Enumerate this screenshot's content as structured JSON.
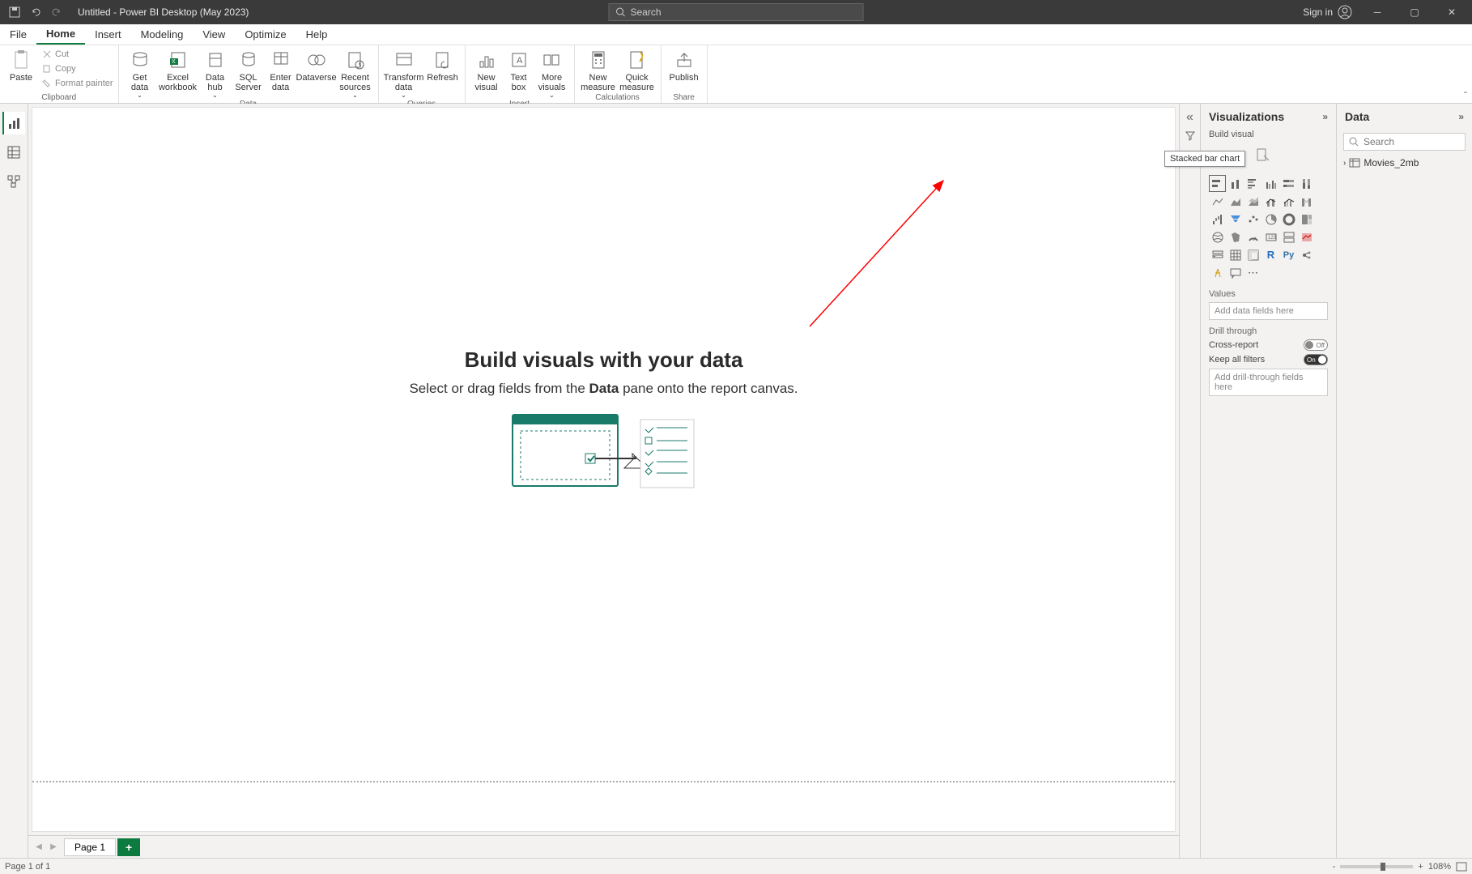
{
  "titlebar": {
    "title": "Untitled - Power BI Desktop (May 2023)",
    "search_placeholder": "Search",
    "signin": "Sign in"
  },
  "menutabs": [
    "File",
    "Home",
    "Insert",
    "Modeling",
    "View",
    "Optimize",
    "Help"
  ],
  "ribbon": {
    "clipboard": {
      "label": "Clipboard",
      "paste": "Paste",
      "cut": "Cut",
      "copy": "Copy",
      "format_painter": "Format painter"
    },
    "data": {
      "label": "Data",
      "get_data": "Get data",
      "excel": "Excel workbook",
      "data_hub": "Data hub",
      "sql": "SQL Server",
      "enter": "Enter data",
      "dataverse": "Dataverse",
      "recent": "Recent sources"
    },
    "queries": {
      "label": "Queries",
      "transform": "Transform data",
      "refresh": "Refresh"
    },
    "insert": {
      "label": "Insert",
      "new_visual": "New visual",
      "text_box": "Text box",
      "more": "More visuals"
    },
    "calc": {
      "label": "Calculations",
      "new_measure": "New measure",
      "quick_measure": "Quick measure"
    },
    "share": {
      "label": "Share",
      "publish": "Publish"
    }
  },
  "canvas": {
    "heading": "Build visuals with your data",
    "subtext_pre": "Select or drag fields from the ",
    "subtext_bold": "Data",
    "subtext_post": " pane onto the report canvas."
  },
  "page_tabs": {
    "page1": "Page 1"
  },
  "viz_pane": {
    "title": "Visualizations",
    "build_visual": "Build visual",
    "tooltip": "Stacked bar chart",
    "values": "Values",
    "add_fields": "Add data fields here",
    "drill_through": "Drill through",
    "cross_report": "Cross-report",
    "cross_report_state": "Off",
    "keep_filters": "Keep all filters",
    "keep_filters_state": "On",
    "add_drill": "Add drill-through fields here"
  },
  "data_pane": {
    "title": "Data",
    "search_placeholder": "Search",
    "table1": "Movies_2mb"
  },
  "statusbar": {
    "page_info": "Page 1 of 1",
    "zoom": "108%"
  }
}
